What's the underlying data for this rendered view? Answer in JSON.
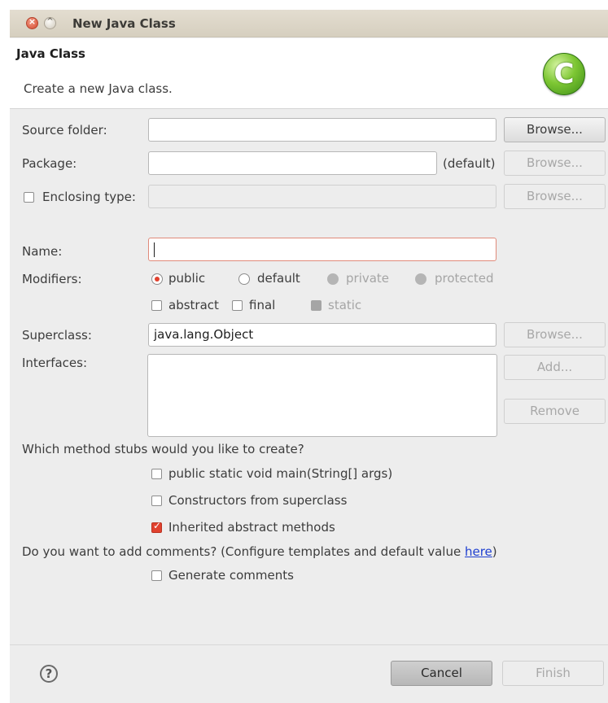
{
  "window": {
    "title": "New Java Class"
  },
  "header": {
    "title": "Java Class",
    "description": "Create a new Java class.",
    "icon_letter": "C"
  },
  "source_folder": {
    "label": "Source folder:",
    "value": "",
    "browse": "Browse..."
  },
  "package": {
    "label": "Package:",
    "value": "",
    "default_hint": "(default)",
    "browse": "Browse..."
  },
  "enclosing": {
    "label": "Enclosing type:",
    "value": "",
    "browse": "Browse..."
  },
  "name": {
    "label": "Name:",
    "value": ""
  },
  "modifiers": {
    "label": "Modifiers:",
    "options": [
      "public",
      "default",
      "private",
      "protected"
    ],
    "selected": "public",
    "checks": [
      "abstract",
      "final",
      "static"
    ]
  },
  "superclass": {
    "label": "Superclass:",
    "value": "java.lang.Object",
    "browse": "Browse..."
  },
  "interfaces": {
    "label": "Interfaces:",
    "add": "Add...",
    "remove": "Remove"
  },
  "stubs": {
    "question": "Which method stubs would you like to create?",
    "items": [
      {
        "label": "public static void main(String[] args)",
        "checked": false
      },
      {
        "label": "Constructors from superclass",
        "checked": false
      },
      {
        "label": "Inherited abstract methods",
        "checked": true
      }
    ]
  },
  "comments": {
    "question": "Do you want to add comments? (Configure templates and default value ",
    "link": "here",
    "question_end": ")",
    "generate": "Generate comments"
  },
  "footer": {
    "help_icon": "?",
    "cancel": "Cancel",
    "finish": "Finish"
  },
  "colors": {
    "accent": "#e1412e",
    "link": "#1e3fd0",
    "icon_green": "#7ec734"
  },
  "icons": {
    "window_close": "close-icon",
    "window_minimize": "minimize-icon",
    "class": "java-class-icon",
    "help": "help-icon"
  }
}
